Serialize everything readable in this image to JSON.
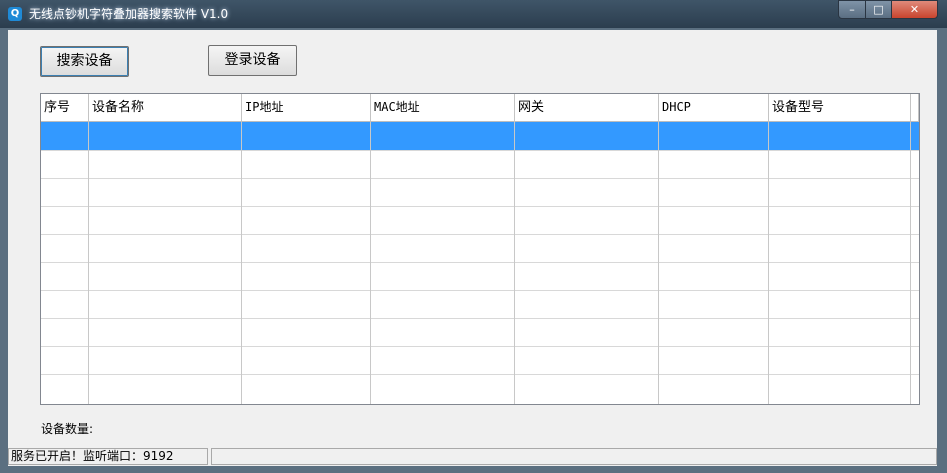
{
  "window": {
    "title": "无线点钞机字符叠加器搜索软件 V1.0",
    "icon": "search-app-icon",
    "controls": {
      "minimize": "minimize-icon",
      "maximize": "maximize-icon",
      "close": "close-icon"
    }
  },
  "toolbar": {
    "search_label": "搜索设备",
    "login_label": "登录设备"
  },
  "table": {
    "columns": [
      "序号",
      "设备名称",
      "IP地址",
      "MAC地址",
      "网关",
      "DHCP",
      "设备型号"
    ],
    "selected_row": 1,
    "rows": []
  },
  "device_count_label": "设备数量:",
  "status": {
    "text": "服务已开启！监听端口：9192",
    "second_pane": ""
  },
  "colors": {
    "selection": "#3399ff",
    "titlebar": "#2f4356",
    "close_button": "#c9442e"
  }
}
